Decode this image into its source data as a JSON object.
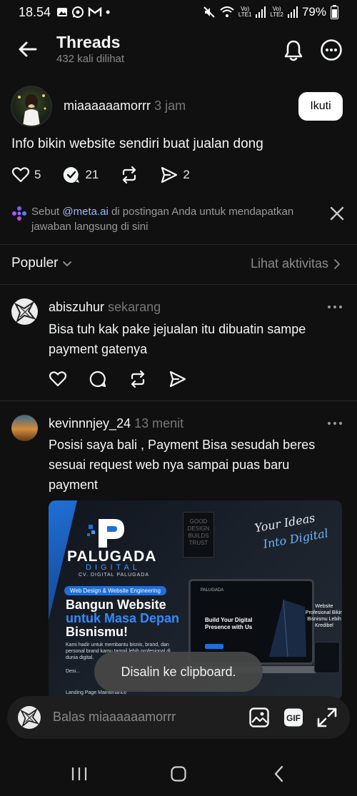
{
  "status_bar": {
    "time": "18.54",
    "dot": "•",
    "net1_top": "Vo)",
    "net1_bottom": "LTE1",
    "net2_top": "Vo)",
    "net2_bottom": "LTE2",
    "battery": "79%",
    "icons": [
      "gallery-icon",
      "whatsapp-icon",
      "gmail-icon",
      "mute-icon",
      "wifi-icon",
      "signal-icon",
      "battery-icon"
    ]
  },
  "header": {
    "title": "Threads",
    "subtitle": "432 kali dilihat"
  },
  "post": {
    "username": "miaaaaaamorrr",
    "time": "3 jam",
    "follow_label": "Ikuti",
    "text": "Info bikin website sendiri buat jualan dong",
    "likes": "5",
    "replies": "21",
    "shares": "2"
  },
  "tip": {
    "prefix": "Sebut ",
    "mention": "@meta.ai",
    "suffix": " di postingan Anda untuk mendapatkan jawaban langsung di sini"
  },
  "sort": {
    "label": "Populer",
    "activity_label": "Lihat aktivitas"
  },
  "replies": [
    {
      "username": "abiszuhur",
      "time": "sekarang",
      "text": "Bisa tuh kak pake jejualan itu dibuatin sampe payment gatenya"
    },
    {
      "username": "kevinnnjey_24",
      "time": "13 menit",
      "text": "Posisi saya bali , Payment Bisa sesudah beres sesuai request web nya sampai puas baru payment"
    }
  ],
  "ad": {
    "brand": "PALUGADA",
    "brand_sub": "DIGITAL",
    "cv": "CV. DIGITAL PALUGADA",
    "pill": "Web Design & Website Engineering",
    "headline1": "Bangun Website",
    "headline2": "untuk Masa Depan",
    "headline3": "Bisnismu!",
    "body": "Kami hadir untuk membantu bisnis, brand, dan personal brand kamu tampil lebih profesional di dunia digital.",
    "sign": "GOOD DESIGN BUILDS TRUST",
    "tagline1": "Your Ideas",
    "tagline2": "Into Digital",
    "screen_logo": "PALUGADA",
    "screen_title": "Build Your Digital Presence with Us",
    "badge": "Website Profesional Bikin Bisnismu Lebih Kredibel",
    "bottom1": "Desi...",
    "bottom2": "Landing Page      Maintenance"
  },
  "toast": "Disalin ke clipboard.",
  "composer": {
    "placeholder": "Balas miaaaaaamorrr"
  },
  "colors": {
    "background": "#101010",
    "text": "#f3f5f7",
    "muted": "#777777",
    "link": "#9fb7ff",
    "accent_blue": "#1f6fd6"
  }
}
